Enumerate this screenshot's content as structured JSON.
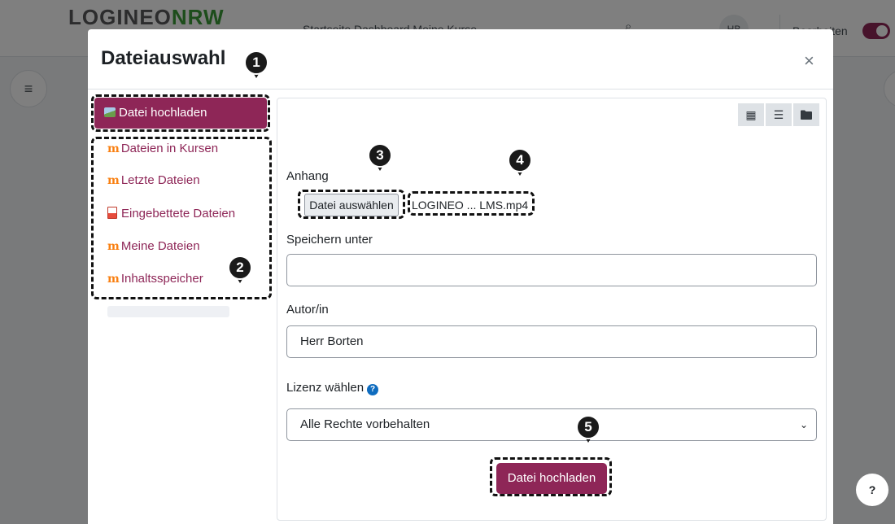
{
  "background": {
    "logo_part1": "LOGINEO",
    "logo_part2": "NRW",
    "nav_links": "Startseite   Dashboard   Meine Kurse",
    "avatar_initials": "HB",
    "edit_mode_label": "Bearbeiten",
    "help_label": "?"
  },
  "modal": {
    "title": "Dateiauswahl",
    "close_symbol": "×"
  },
  "sidebar": {
    "active_label": "Datei hochladen",
    "items": [
      {
        "label": "Dateien in Kursen",
        "icon": "moodle-icon"
      },
      {
        "label": "Letzte Dateien",
        "icon": "moodle-icon"
      },
      {
        "label": "Eingebettete Dateien",
        "icon": "pdf-icon"
      },
      {
        "label": "Meine Dateien",
        "icon": "moodle-icon"
      },
      {
        "label": "Inhaltsspeicher",
        "icon": "moodle-icon"
      }
    ]
  },
  "toolbar": {
    "grid_view": "▦",
    "list_view": "☰",
    "tree_view": "▬"
  },
  "form": {
    "attachment_label": "Anhang",
    "choose_file_label": "Datei auswählen",
    "file_name": "LOGINEO ... LMS.mp4",
    "save_as_label": "Speichern unter",
    "save_as_value": "",
    "author_label": "Autor/in",
    "author_value": "Herr Borten",
    "license_label": "Lizenz wählen",
    "license_value": "Alle Rechte vorbehalten",
    "submit_label": "Datei hochladen"
  },
  "annotations": {
    "markers": [
      "1",
      "2",
      "3",
      "4",
      "5"
    ]
  },
  "colors": {
    "accent": "#8e2657",
    "backdrop": "rgba(0,0,0,0.5)",
    "help_icon": "#0f6cbf"
  }
}
